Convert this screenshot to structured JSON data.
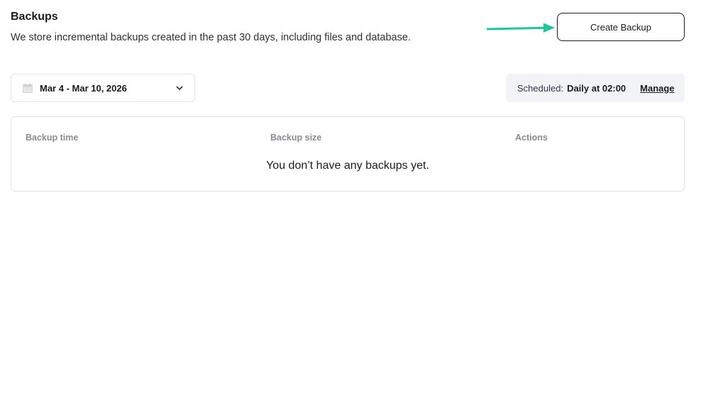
{
  "header": {
    "title": "Backups",
    "subtitle": "We store incremental backups created in the past 30 days, including files and database."
  },
  "actions": {
    "create_label": "Create Backup"
  },
  "filters": {
    "date_range": "Mar 4 - Mar 10, 2026",
    "calendar_icon": "calendar-icon",
    "dropdown_icon": "chevron-down-icon"
  },
  "schedule": {
    "label": "Scheduled:",
    "value": "Daily at 02:00",
    "manage_label": "Manage"
  },
  "table": {
    "columns": [
      "Backup time",
      "Backup size",
      "Actions"
    ],
    "empty_message": "You don’t have any backups yet."
  },
  "colors": {
    "accent_arrow": "#1fc4a0",
    "text_primary": "#1b1b1f",
    "header_muted": "#8a8a94",
    "schedule_bg": "#f2f3f6"
  }
}
